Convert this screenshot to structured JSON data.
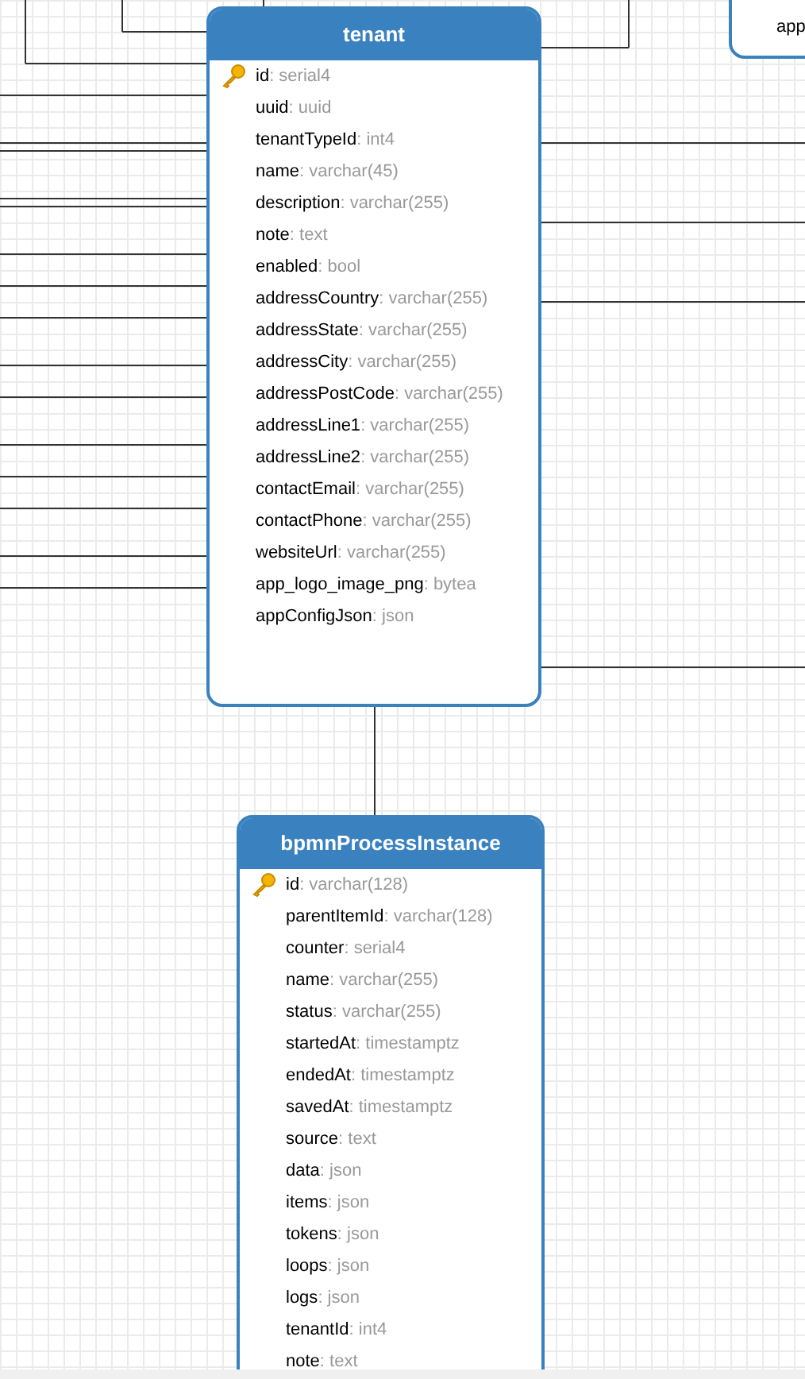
{
  "tables": [
    {
      "title": "tenant",
      "fields": [
        {
          "name": "id",
          "type": ": serial4",
          "primary_key": true
        },
        {
          "name": "uuid",
          "type": ": uuid",
          "primary_key": false
        },
        {
          "name": "tenantTypeId",
          "type": ": int4",
          "primary_key": false
        },
        {
          "name": "name",
          "type": ": varchar(45)",
          "primary_key": false
        },
        {
          "name": "description",
          "type": ": varchar(255)",
          "primary_key": false
        },
        {
          "name": "note",
          "type": ": text",
          "primary_key": false
        },
        {
          "name": "enabled",
          "type": ": bool",
          "primary_key": false
        },
        {
          "name": "addressCountry",
          "type": ": varchar(255)",
          "primary_key": false
        },
        {
          "name": "addressState",
          "type": ": varchar(255)",
          "primary_key": false
        },
        {
          "name": "addressCity",
          "type": ": varchar(255)",
          "primary_key": false
        },
        {
          "name": "addressPostCode",
          "type": ": varchar(255)",
          "primary_key": false
        },
        {
          "name": "addressLine1",
          "type": ": varchar(255)",
          "primary_key": false
        },
        {
          "name": "addressLine2",
          "type": ": varchar(255)",
          "primary_key": false
        },
        {
          "name": "contactEmail",
          "type": ": varchar(255)",
          "primary_key": false
        },
        {
          "name": "contactPhone",
          "type": ": varchar(255)",
          "primary_key": false
        },
        {
          "name": "websiteUrl",
          "type": ": varchar(255)",
          "primary_key": false
        },
        {
          "name": "app_logo_image_png",
          "type": ": bytea",
          "primary_key": false
        },
        {
          "name": "appConfigJson",
          "type": ": json",
          "primary_key": false
        }
      ]
    },
    {
      "title": "bpmnProcessInstance",
      "fields": [
        {
          "name": "id",
          "type": ": varchar(128)",
          "primary_key": true
        },
        {
          "name": "parentItemId",
          "type": ": varchar(128)",
          "primary_key": false
        },
        {
          "name": "counter",
          "type": ": serial4",
          "primary_key": false
        },
        {
          "name": "name",
          "type": ": varchar(255)",
          "primary_key": false
        },
        {
          "name": "status",
          "type": ": varchar(255)",
          "primary_key": false
        },
        {
          "name": "startedAt",
          "type": ": timestamptz",
          "primary_key": false
        },
        {
          "name": "endedAt",
          "type": ": timestamptz",
          "primary_key": false
        },
        {
          "name": "savedAt",
          "type": ": timestamptz",
          "primary_key": false
        },
        {
          "name": "source",
          "type": ": text",
          "primary_key": false
        },
        {
          "name": "data",
          "type": ": json",
          "primary_key": false
        },
        {
          "name": "items",
          "type": ": json",
          "primary_key": false
        },
        {
          "name": "tokens",
          "type": ": json",
          "primary_key": false
        },
        {
          "name": "loops",
          "type": ": json",
          "primary_key": false
        },
        {
          "name": "logs",
          "type": ": json",
          "primary_key": false
        },
        {
          "name": "tenantId",
          "type": ": int4",
          "primary_key": false
        },
        {
          "name": "note",
          "type": ": text",
          "primary_key": false
        }
      ]
    },
    {
      "fields": [
        {
          "name": "app",
          "primary_key": false
        }
      ]
    }
  ]
}
